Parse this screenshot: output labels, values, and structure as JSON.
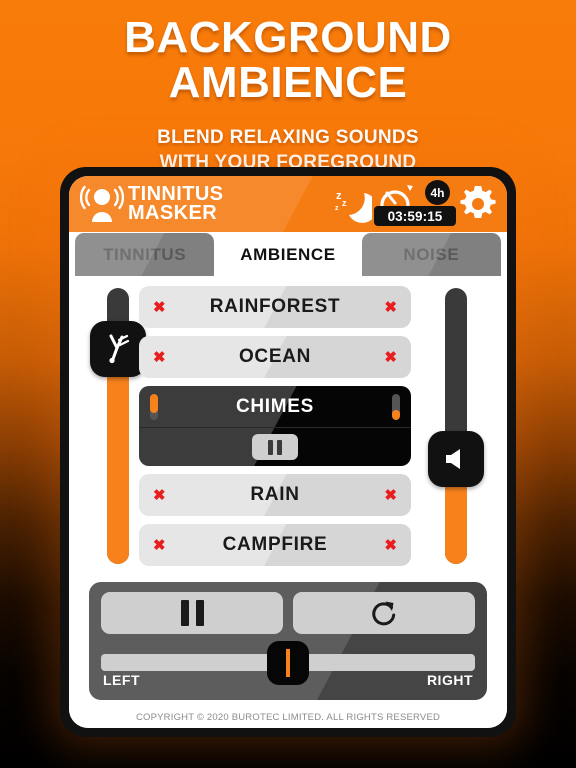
{
  "promo": {
    "headline_line1": "BACKGROUND",
    "headline_line2": "AMBIENCE",
    "sub_line1": "BLEND RELAXING SOUNDS",
    "sub_line2": "WITH YOUR FOREGROUND"
  },
  "header": {
    "logo_icon": "person-sound-waves-icon",
    "title_line1": "TINNITUS",
    "title_line2": "MASKER",
    "sleep_icon": "moon-zzz-icon",
    "timer_icon": "timer-dial-icon",
    "timer_duration_badge": "4h",
    "timer_countdown": "03:59:15",
    "settings_icon": "gear-icon"
  },
  "tabs": [
    {
      "label": "TINNITUS",
      "active": false
    },
    {
      "label": "AMBIENCE",
      "active": true
    },
    {
      "label": "NOISE",
      "active": false
    }
  ],
  "sliders": {
    "left": {
      "icon": "tuning-fork-icon",
      "value_pct": 78
    },
    "right": {
      "icon": "speaker-volume-icon",
      "value_pct": 38
    }
  },
  "sounds": [
    {
      "label": "RAINFOREST",
      "active": false,
      "marker": "✖"
    },
    {
      "label": "OCEAN",
      "active": false,
      "marker": "✖"
    },
    {
      "label": "CHIMES",
      "active": true,
      "left_level_pct": 72,
      "right_level_pct": 38,
      "play_state_icon": "pause-icon"
    },
    {
      "label": "RAIN",
      "active": false,
      "marker": "✖"
    },
    {
      "label": "CAMPFIRE",
      "active": false,
      "marker": "✖"
    }
  ],
  "transport": {
    "pause_icon": "pause-icon",
    "loop_icon": "loop-refresh-icon",
    "pan_left_label": "LEFT",
    "pan_right_label": "RIGHT",
    "pan_value_pct": 50
  },
  "footer": {
    "copyright": "COPYRIGHT © 2020 BUROTEC LIMITED. ALL RIGHTS RESERVED"
  },
  "colors": {
    "brand_orange": "#F57C13",
    "slider_orange": "#F7821C",
    "marker_red": "#E81E1E",
    "bezel_black": "#111111"
  }
}
